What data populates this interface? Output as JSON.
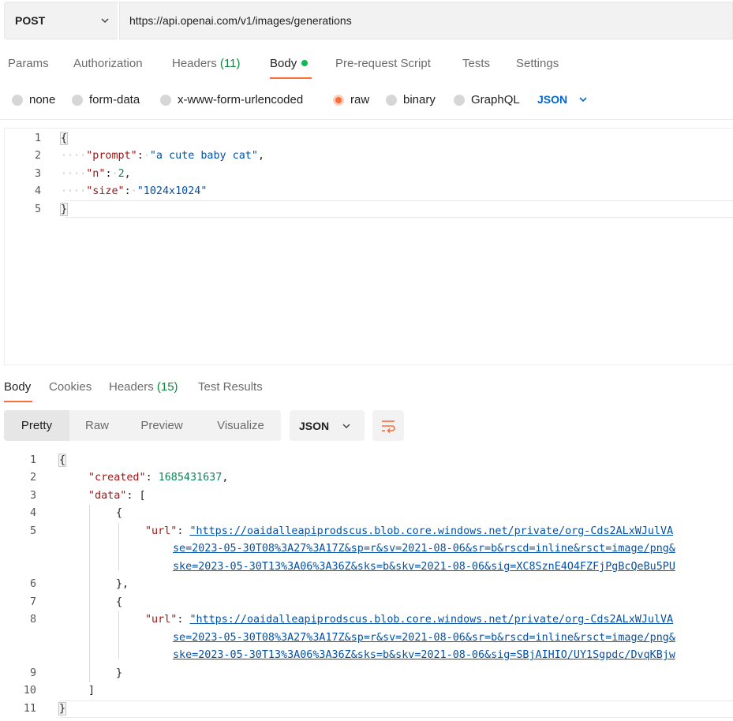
{
  "request": {
    "method": "POST",
    "url": "https://api.openai.com/v1/images/generations"
  },
  "request_tabs": {
    "params": "Params",
    "authorization": "Authorization",
    "headers": "Headers",
    "headers_count": "(11)",
    "body": "Body",
    "pre_request": "Pre-request Script",
    "tests": "Tests",
    "settings": "Settings"
  },
  "body_types": {
    "none": "none",
    "form_data": "form-data",
    "urlencoded": "x-www-form-urlencoded",
    "raw": "raw",
    "binary": "binary",
    "graphql": "GraphQL",
    "selected": "raw",
    "format": "JSON"
  },
  "request_body": {
    "line_numbers": [
      "1",
      "2",
      "3",
      "4",
      "5"
    ],
    "open": "{",
    "prompt_key": "\"prompt\"",
    "prompt_val": "\"a cute baby cat\"",
    "n_key": "\"n\"",
    "n_val": "2",
    "size_key": "\"size\"",
    "size_val": "\"1024x1024\"",
    "close": "}"
  },
  "response_tabs": {
    "body": "Body",
    "cookies": "Cookies",
    "headers": "Headers",
    "headers_count": "(15)",
    "test_results": "Test Results"
  },
  "view_modes": {
    "pretty": "Pretty",
    "raw": "Raw",
    "preview": "Preview",
    "visualize": "Visualize",
    "format": "JSON"
  },
  "response_body": {
    "line_numbers": [
      "1",
      "2",
      "3",
      "4",
      "5",
      "",
      "",
      "6",
      "7",
      "8",
      "",
      "",
      "9",
      "10",
      "11"
    ],
    "created_key": "\"created\"",
    "created_val": "1685431637",
    "data_key": "\"data\"",
    "url_key": "\"url\"",
    "url1_a": "\"https://oaidalleapiprodscus.blob.core.windows.net/private/org-Cds2ALxWJulVA",
    "url1_b": "se=2023-05-30T08%3A27%3A17Z&sp=r&sv=2021-08-06&sr=b&rscd=inline&rsct=image/png&",
    "url1_c": "ske=2023-05-30T13%3A06%3A36Z&sks=b&skv=2021-08-06&sig=XC8SznE4O4FZFjPgBcQeBu5PU",
    "url2_a": "\"https://oaidalleapiprodscus.blob.core.windows.net/private/org-Cds2ALxWJulVA",
    "url2_b": "se=2023-05-30T08%3A27%3A17Z&sp=r&sv=2021-08-06&sr=b&rscd=inline&rsct=image/png&",
    "url2_c": "ske=2023-05-30T13%3A06%3A36Z&sks=b&skv=2021-08-06&sig=SBjAIHIO/UY1Sgpdc/DvqKBjw"
  },
  "icons": {
    "method_dropdown": "chevron-down-icon",
    "format_dropdown": "chevron-down-icon",
    "wrap": "wrap-lines-icon"
  },
  "colors": {
    "accent": "#ff6c37",
    "active_dot": "#0cbb52",
    "count": "#0a8a3a",
    "json_link": "#0265d2"
  }
}
